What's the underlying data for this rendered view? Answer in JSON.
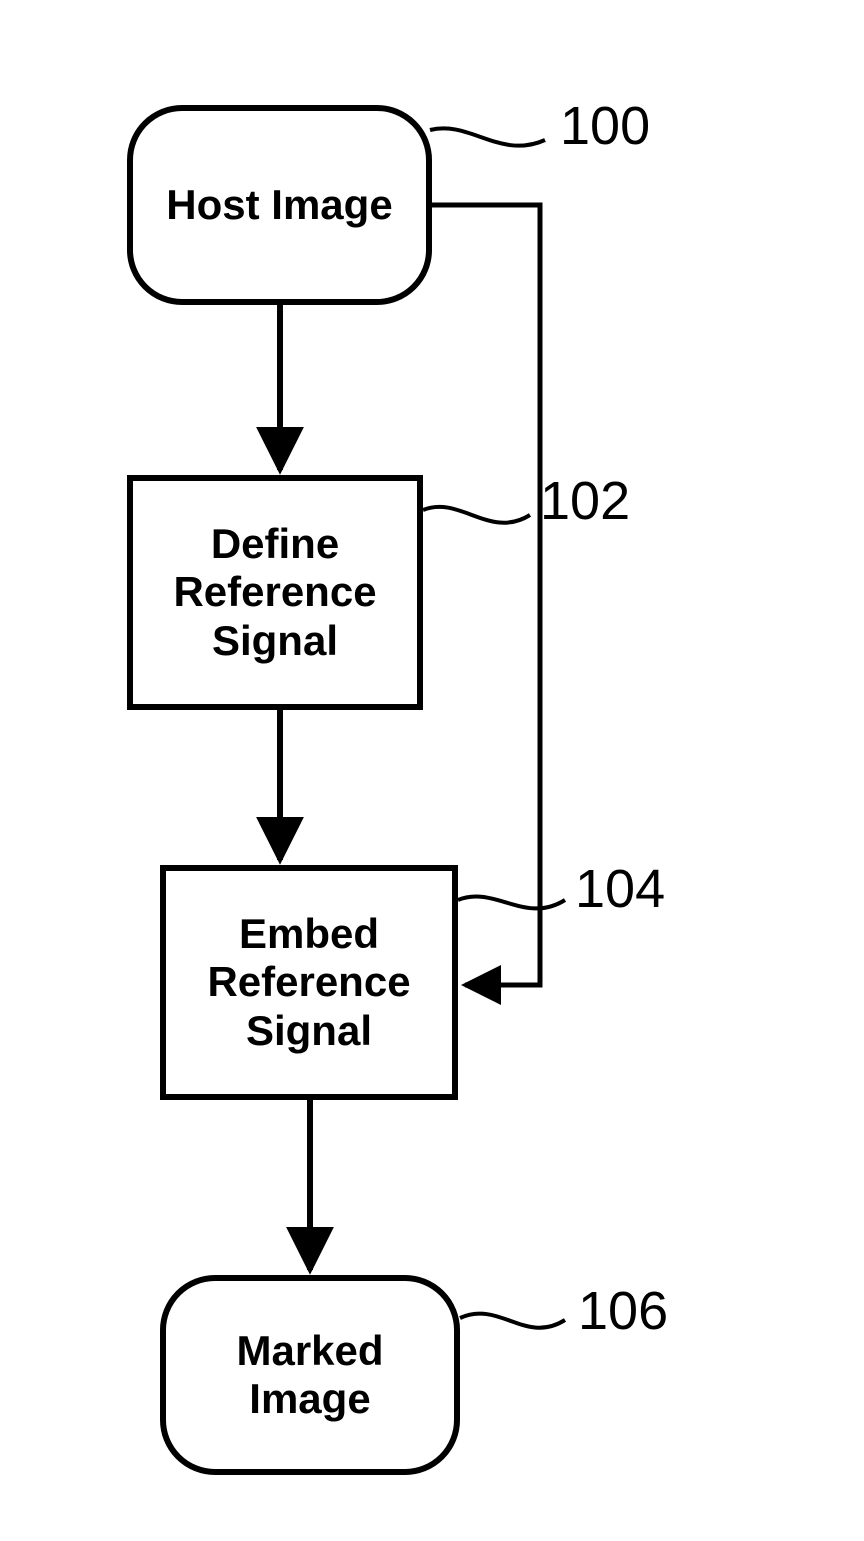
{
  "nodes": {
    "host": {
      "text": "Host Image",
      "ref": "100"
    },
    "define": {
      "text": "Define\nReference\nSignal",
      "ref": "102"
    },
    "embed": {
      "text": "Embed\nReference\nSignal",
      "ref": "104"
    },
    "marked": {
      "text": "Marked\nImage",
      "ref": "106"
    }
  }
}
